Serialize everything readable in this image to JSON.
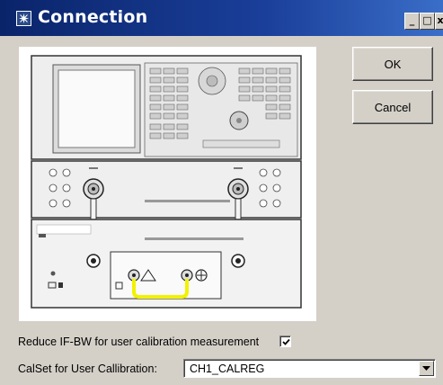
{
  "window": {
    "title": "Connection",
    "icon": "window-app-icon",
    "controls": {
      "minimize": "_",
      "maximize": "□",
      "close": "x"
    }
  },
  "picture": {
    "icon": "instrument-connection-diagram",
    "colors": {
      "cable": "#f2f200",
      "panel": "#e6e6e6",
      "outline": "#333333"
    }
  },
  "buttons": {
    "ok": "OK",
    "cancel": "Cancel"
  },
  "reduce_ifbw": {
    "label": "Reduce IF-BW for user calibration measurement",
    "checked": true
  },
  "calset": {
    "label": "CalSet for User Callibration:",
    "value": "CH1_CALREG"
  }
}
